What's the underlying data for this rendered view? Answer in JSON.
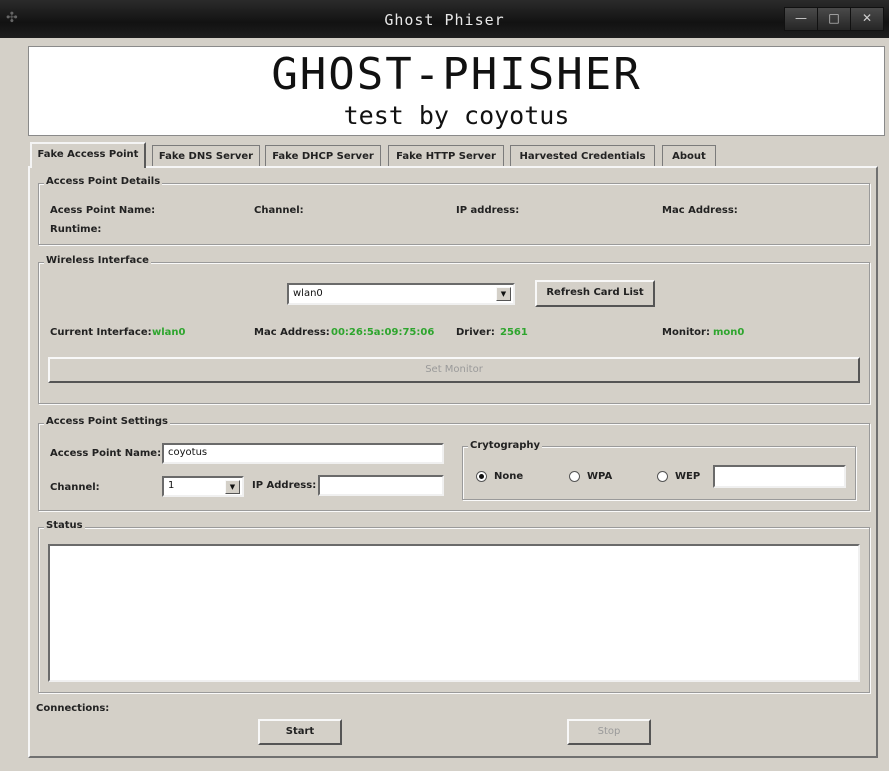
{
  "window": {
    "title": "Ghost Phiser"
  },
  "banner": {
    "line1": "GHOST-PHISHER",
    "line2": "test by coyotus"
  },
  "tabs": [
    {
      "label": "Fake Access Point"
    },
    {
      "label": "Fake DNS Server"
    },
    {
      "label": "Fake DHCP Server"
    },
    {
      "label": "Fake HTTP Server"
    },
    {
      "label": "Harvested Credentials"
    },
    {
      "label": "About"
    }
  ],
  "ap_details": {
    "legend": "Access Point Details",
    "name_label": "Acess Point Name:",
    "channel_label": "Channel:",
    "ip_label": "IP address:",
    "mac_label": "Mac Address:",
    "runtime_label": "Runtime:"
  },
  "wireless": {
    "legend": "Wireless Interface",
    "interface_value": "wlan0",
    "refresh_label": "Refresh Card List",
    "current_label": "Current Interface:",
    "current_value": "wlan0",
    "mac_label": "Mac Address:",
    "mac_value": "00:26:5a:09:75:06",
    "driver_label": "Driver:",
    "driver_value": "2561",
    "monitor_label": "Monitor:",
    "monitor_value": "mon0",
    "set_monitor_label": "Set Monitor"
  },
  "ap_settings": {
    "legend": "Access Point Settings",
    "name_label": "Access Point Name:",
    "name_value": "coyotus",
    "channel_label": "Channel:",
    "channel_value": "1",
    "ip_label": "IP Address:",
    "ip_value": "",
    "crypto_legend": "Crytography",
    "crypto_none": "None",
    "crypto_wpa": "WPA",
    "crypto_wep": "WEP",
    "wep_key": ""
  },
  "status": {
    "legend": "Status",
    "text": ""
  },
  "footer": {
    "connections_label": "Connections:",
    "start_label": "Start",
    "stop_label": "Stop"
  }
}
